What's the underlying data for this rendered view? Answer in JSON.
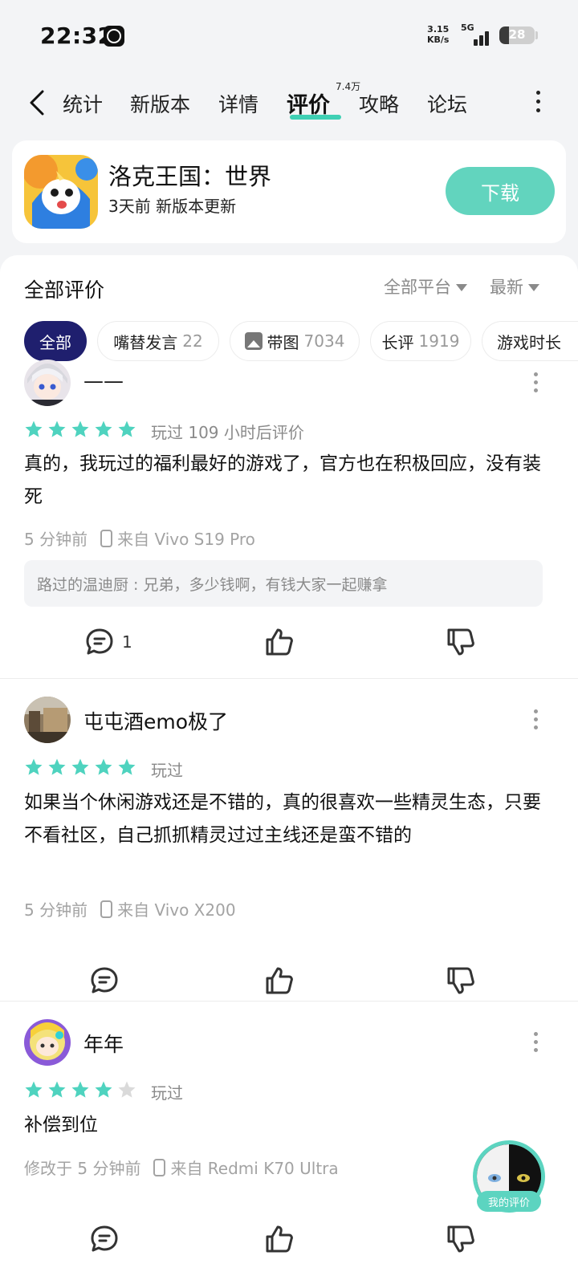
{
  "status_bar": {
    "time": "22:32",
    "net_speed_value": "3.15",
    "net_speed_unit": "KB/s",
    "net_type": "5G",
    "battery": "28",
    "battery_level": 0.28
  },
  "nav": {
    "tabs": [
      {
        "label": "统计"
      },
      {
        "label": "新版本"
      },
      {
        "label": "详情"
      },
      {
        "label": "评价",
        "badge": "7.4万"
      },
      {
        "label": "攻略"
      },
      {
        "label": "论坛"
      }
    ],
    "active_tab": "评价"
  },
  "app": {
    "name": "洛克王国：世界",
    "subtitle": "3天前 新版本更新",
    "download_label": "下载"
  },
  "reviews_section": {
    "title": "全部评价",
    "platform_filter": "全部平台",
    "sort_filter": "最新",
    "chips": [
      {
        "label": "全部",
        "count": ""
      },
      {
        "label": "嘴替发言",
        "count": "22"
      },
      {
        "label": "带图",
        "count": "7034"
      },
      {
        "label": "长评",
        "count": "1919"
      },
      {
        "label": "游戏时长",
        "count": ""
      }
    ]
  },
  "reviews": [
    {
      "username": "——",
      "rating": 5,
      "played": "玩过 109 小时后评价",
      "text": "真的，我玩过的福利最好的游戏了，官方也在积极回应，没有装死",
      "time": "5 分钟前",
      "device": "来自 Vivo S19 Pro",
      "reply": "路过的温迪厨 : 兄弟，多少钱啊，有钱大家一起赚拿",
      "comment_count": "1"
    },
    {
      "username": "屯屯酒emo极了",
      "rating": 5,
      "played": "玩过",
      "text": "如果当个休闲游戏还是不错的，真的很喜欢一些精灵生态，只要不看社区，自己抓抓精灵过过主线还是蛮不错的",
      "time": "5 分钟前",
      "device": "来自 Vivo X200",
      "comment_count": ""
    },
    {
      "username": "年年",
      "rating": 4,
      "played": "玩过",
      "text": "补偿到位",
      "time": "修改于 5 分钟前",
      "device": "来自 Redmi K70 Ultra",
      "comment_count": ""
    }
  ],
  "my_review_label": "我的评价",
  "colors": {
    "accent": "#3fd0b4",
    "star_filled": "#4fd3bf",
    "star_empty": "#dadada",
    "chip_active": "#1f1f6e"
  }
}
